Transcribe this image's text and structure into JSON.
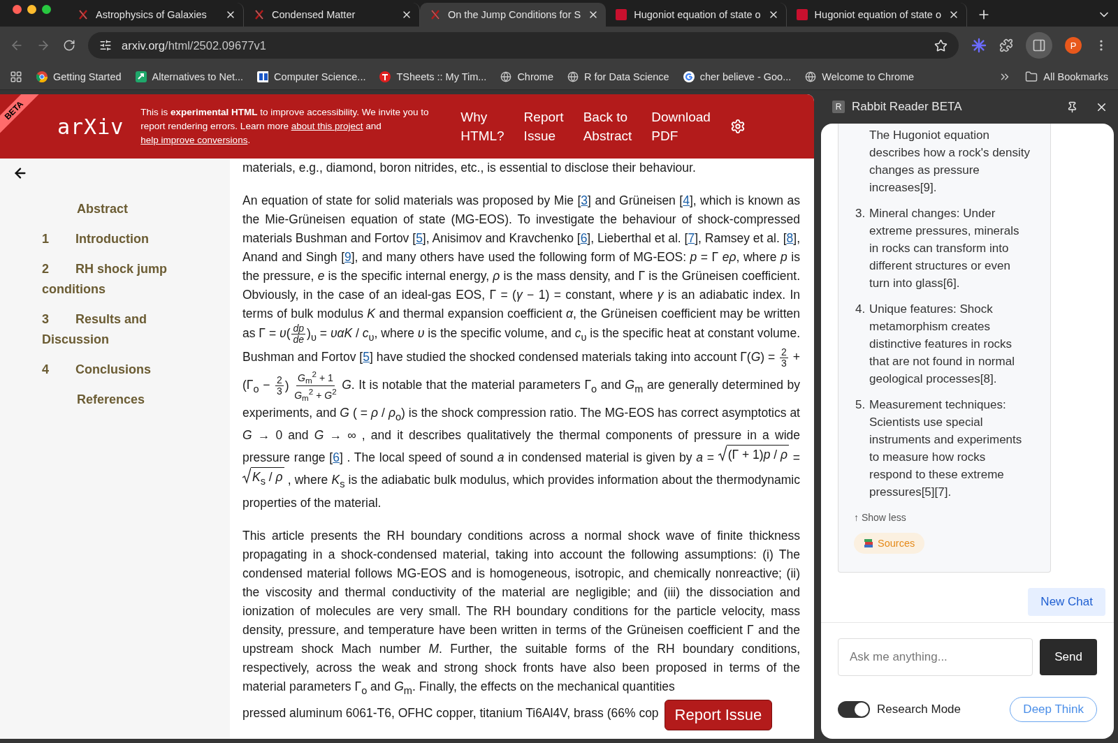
{
  "browser": {
    "tabs": [
      {
        "title": "Astrophysics of Galaxies",
        "selected": false
      },
      {
        "title": "Condensed Matter",
        "selected": false
      },
      {
        "title": "On the Jump Conditions for S",
        "selected": true
      },
      {
        "title": "Hugoniot equation of state o",
        "selected": false
      },
      {
        "title": "Hugoniot equation of state o",
        "selected": false
      }
    ],
    "url": {
      "host": "arxiv.org",
      "path": "/html/2502.09677v1"
    },
    "profile_initial": "P",
    "bookmarks": [
      "Getting Started",
      "Alternatives to Net...",
      "Computer Science...",
      "TSheets :: My Tim...",
      "Chrome",
      "R for Data Science",
      "cher believe - Goo...",
      "Welcome to Chrome"
    ],
    "all_bookmarks": "All Bookmarks"
  },
  "page": {
    "ribbon": "BETA",
    "logo": "arXiv",
    "notice": [
      {
        "kind": "text",
        "text": "This is **experimental HTML** to improve accessibility. We invite you to report rendering errors. Learn more "
      },
      {
        "kind": "link",
        "text": "about this project"
      },
      {
        "kind": "text",
        "text": " and "
      },
      {
        "kind": "link",
        "text": "help improve conversions"
      },
      {
        "kind": "text",
        "text": "."
      }
    ],
    "nav": [
      "Why HTML?",
      "Report Issue",
      "Back to Abstract",
      "Download PDF"
    ],
    "toc": [
      {
        "label": "Abstract"
      },
      {
        "number": "1",
        "label": "Introduction"
      },
      {
        "number": "2",
        "label": "RH shock jump conditions"
      },
      {
        "number": "3",
        "label": "Results and Discussion"
      },
      {
        "number": "4",
        "label": "Conclusions"
      },
      {
        "label": "References"
      }
    ],
    "paragraphs": [
      [
        {
          "kind": "text",
          "text": "materials, e.g., diamond, boron nitrides, etc., is essential to disclose their behaviour."
        }
      ],
      [
        {
          "kind": "text",
          "text": "An equation of state for solid materials was proposed by Mie ["
        },
        {
          "kind": "ref",
          "text": "3"
        },
        {
          "kind": "text",
          "text": "] and Grüneisen  ["
        },
        {
          "kind": "ref",
          "text": "4"
        },
        {
          "kind": "text",
          "text": "], which is known as the Mie-Grüneisen equation of state (MG-EOS). To investigate the behaviour of shock-compressed materials Bushman and Fortov  ["
        },
        {
          "kind": "ref",
          "text": "5"
        },
        {
          "kind": "text",
          "text": "], Anisimov and Kravchenko  ["
        },
        {
          "kind": "ref",
          "text": "6"
        },
        {
          "kind": "text",
          "text": "], Lieberthal et al.  ["
        },
        {
          "kind": "ref",
          "text": "7"
        },
        {
          "kind": "text",
          "text": "], Ramsey et al.  ["
        },
        {
          "kind": "ref",
          "text": "8"
        },
        {
          "kind": "text",
          "text": "], Anand and Singh  ["
        },
        {
          "kind": "ref",
          "text": "9"
        },
        {
          "kind": "text",
          "text": "], and many others have used the following form of MG-EOS: *p* = Γ *eρ*, where *p* is the pressure, *e* is the specific internal energy, *ρ* is the mass density, and Γ is the Grüneisen coefficient. Obviously, in the case of an ideal-gas EOS, Γ = (*γ* − 1) =  constant, where *γ* is an adiabatic index. In terms of bulk modulus *K* and thermal expansion coefficient *α*, the Grüneisen coefficient may be written as Γ = *υ*("
        },
        {
          "kind": "frac",
          "num": "*dp*",
          "den": "*de*"
        },
        {
          "kind": "text",
          "text": ")$_{υ}$ = *υαK* / *c*$_{υ}$, where *υ* is the specific volume, and *c*$_{υ}$ is the specific heat at constant volume. Bushman and Fortov ["
        },
        {
          "kind": "ref",
          "text": "5"
        },
        {
          "kind": "text",
          "text": "] have studied the shocked condensed materials taking into account Γ(*G*) = "
        },
        {
          "kind": "frac",
          "num": "2",
          "den": "3"
        },
        {
          "kind": "text",
          "text": " + (Γ$_{o}$ − "
        },
        {
          "kind": "frac",
          "num": "2",
          "den": "3"
        },
        {
          "kind": "text",
          "text": ") "
        },
        {
          "kind": "frac",
          "num": "*G*$_{m}$$^{2}$ + 1",
          "den": "*G*$_{m}$$^{2}$ + *G*$^{2}$"
        },
        {
          "kind": "text",
          "text": " *G*. It is notable that the material parameters Γ$_{o}$ and *G*$_{m}$ are generally determined by experiments, and *G* ( = *ρ* / *ρ*$_{o}$) is the shock compression ratio. The MG-EOS has correct asymptotics at *G* → 0 and *G* → ∞ , and it describes qualitatively the thermal components of pressure in a wide pressure range ["
        },
        {
          "kind": "ref",
          "text": "6"
        },
        {
          "kind": "text",
          "text": "] . The local speed of sound *a* in condensed material is given by *a* = "
        },
        {
          "kind": "sqrt",
          "text": "(Γ + 1)*p* / *ρ*"
        },
        {
          "kind": "text",
          "text": "  = "
        },
        {
          "kind": "sqrt",
          "text": "*K*$_{s}$ / *ρ*"
        },
        {
          "kind": "text",
          "text": " , where *K*$_{s}$ is the adiabatic bulk modulus, which provides information about the thermodynamic properties of the material."
        }
      ],
      [
        {
          "kind": "text",
          "text": "This article presents the RH boundary conditions across a normal shock wave of finite thickness propagating in a shock-condensed material, taking into account the following assumptions: (i) The condensed material follows MG-EOS and is homogeneous, isotropic, and chemically nonreactive; (ii) the viscosity and thermal conductivity of the material are negligible; and (iii) the dissociation and ionization of molecules are very small. The RH boundary conditions for the particle velocity, mass density, pressure, and temperature have been written in terms of the Grüneisen coefficient Γ and the upstream shock Mach number *M*. Further, the suitable forms of the RH boundary conditions, respectively, across the weak and strong shock fronts have also been proposed in terms of the material parameters Γ$_{o}$ and *G*$_{m}$. Finally, the effects on the mechanical quantities"
        }
      ]
    ],
    "fragment": "pressed aluminum 6061-T6, OFHC copper, titanium Ti6Al4V, brass (66% cop",
    "report_button": "Report Issue"
  },
  "side_panel": {
    "badge": "R",
    "title": "Rabbit Reader BETA",
    "answer_items": [
      {
        "text": "The Hugoniot equation describes how a rock's density changes as pressure increases[9]."
      },
      {
        "number": "3.",
        "text": "Mineral changes: Under extreme pressures, minerals in rocks can transform into different structures or even turn into glass[6]."
      },
      {
        "number": "4.",
        "text": "Unique features: Shock metamorphism creates distinctive features in rocks that are not found in normal geological processes[8]."
      },
      {
        "number": "5.",
        "text": "Measurement techniques: Scientists use special instruments and experiments to measure how rocks respond to these extreme pressures[5][7]."
      }
    ],
    "show_less": "↑ Show less",
    "sources": "Sources",
    "new_chat": "New Chat",
    "input": {
      "placeholder": "Ask me anything..."
    },
    "send": "Send",
    "research_mode": {
      "label": "Research Mode",
      "on": true
    },
    "deep_think": "Deep Think"
  }
}
